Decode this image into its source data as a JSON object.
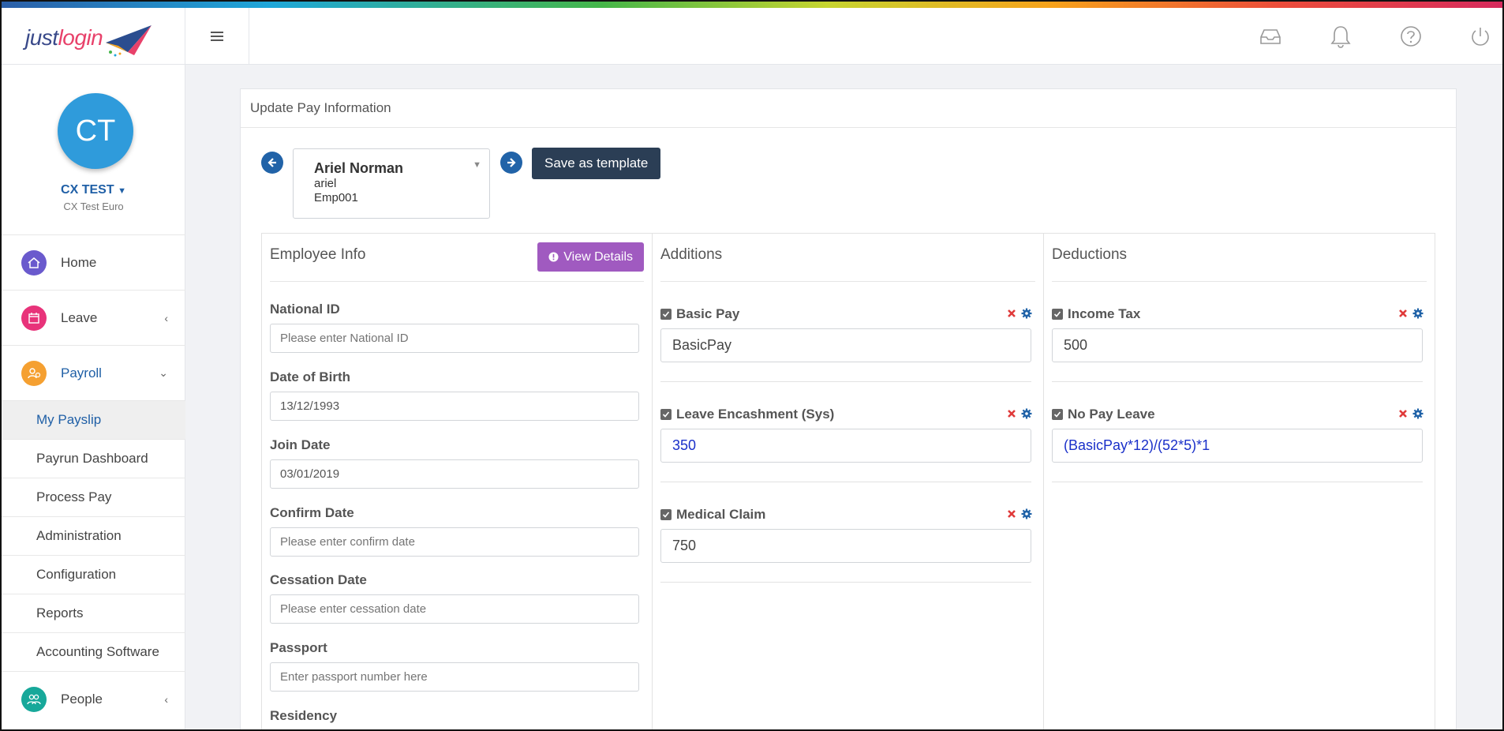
{
  "brand": {
    "logo_part1": "just",
    "logo_part2": "login"
  },
  "user": {
    "initials": "CT",
    "name": "CX TEST",
    "company": "CX Test Euro"
  },
  "nav": {
    "home": "Home",
    "leave": "Leave",
    "payroll": "Payroll",
    "payroll_items": [
      "My Payslip",
      "Payrun Dashboard",
      "Process Pay",
      "Administration",
      "Configuration",
      "Reports",
      "Accounting Software"
    ],
    "people": "People"
  },
  "page": {
    "title": "Update Pay Information",
    "save_template": "Save as template"
  },
  "employee": {
    "name": "Ariel Norman",
    "username": "ariel",
    "emp_id": "Emp001"
  },
  "employee_info": {
    "title": "Employee Info",
    "view_details": "View Details",
    "fields": [
      {
        "label": "National ID",
        "value": "",
        "placeholder": "Please enter National ID"
      },
      {
        "label": "Date of Birth",
        "value": "13/12/1993",
        "placeholder": ""
      },
      {
        "label": "Join Date",
        "value": "03/01/2019",
        "placeholder": ""
      },
      {
        "label": "Confirm Date",
        "value": "",
        "placeholder": "Please enter confirm date"
      },
      {
        "label": "Cessation Date",
        "value": "",
        "placeholder": "Please enter cessation date"
      },
      {
        "label": "Passport",
        "value": "",
        "placeholder": "Enter passport number here"
      }
    ],
    "residency_label": "Residency"
  },
  "additions": {
    "title": "Additions",
    "items": [
      {
        "label": "Basic Pay",
        "value": "BasicPay"
      },
      {
        "label": "Leave Encashment (Sys)",
        "value": "350"
      },
      {
        "label": "Medical Claim",
        "value": "750"
      }
    ]
  },
  "deductions": {
    "title": "Deductions",
    "items": [
      {
        "label": "Income Tax",
        "value": "500"
      },
      {
        "label": "No Pay Leave",
        "value": "(BasicPay*12)/(52*5)*1"
      }
    ]
  },
  "colors": {
    "accent": "#2163a8",
    "view_details": "#a05ac0",
    "template_button": "#2b3e55",
    "formula": "#1a30c9"
  }
}
